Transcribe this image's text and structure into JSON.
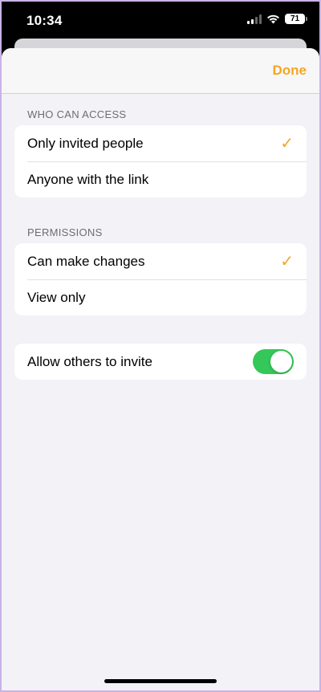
{
  "status_bar": {
    "time": "10:34",
    "battery": "71",
    "icons": [
      "cellular-signal-icon",
      "wifi-icon",
      "battery-icon"
    ]
  },
  "nav": {
    "done_label": "Done",
    "accent_color": "#f5a623"
  },
  "access": {
    "header": "WHO CAN ACCESS",
    "options": [
      {
        "label": "Only invited people",
        "selected": true
      },
      {
        "label": "Anyone with the link",
        "selected": false
      }
    ]
  },
  "permissions": {
    "header": "PERMISSIONS",
    "options": [
      {
        "label": "Can make changes",
        "selected": true
      },
      {
        "label": "View only",
        "selected": false
      }
    ]
  },
  "invite": {
    "label": "Allow others to invite",
    "enabled": true,
    "toggle_color": "#34c759"
  },
  "checkmark_glyph": "✓"
}
